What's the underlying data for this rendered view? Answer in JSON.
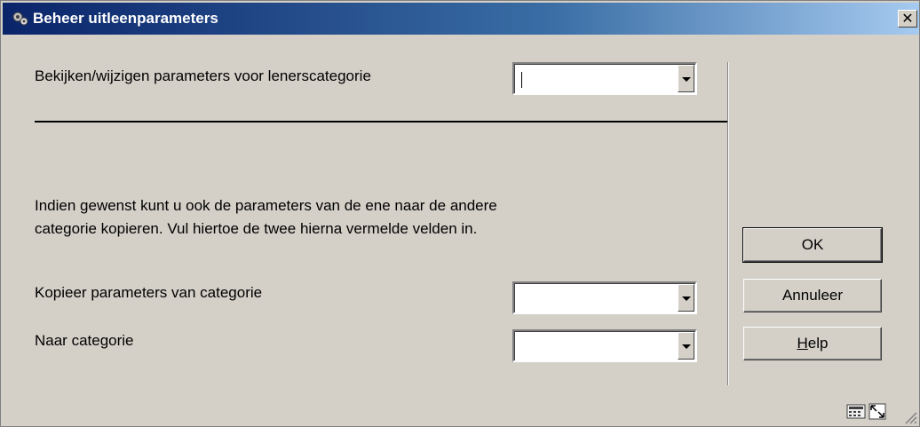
{
  "window": {
    "title": "Beheer uitleenparameters",
    "close_glyph": "✕"
  },
  "form": {
    "view_label": "Bekijken/wijzigen parameters voor lenerscategorie",
    "view_value": "",
    "info_line1": "Indien gewenst kunt u ook de parameters van de ene naar de andere",
    "info_line2": "categorie kopieren. Vul hiertoe de twee hierna vermelde velden in.",
    "copy_from_label": "Kopieer parameters van categorie",
    "copy_from_value": "",
    "copy_to_label": "Naar categorie",
    "copy_to_value": ""
  },
  "buttons": {
    "ok": "OK",
    "cancel": "Annuleer",
    "help_prefix": "H",
    "help_rest": "elp"
  },
  "icons": {
    "title": "app-gear-icon",
    "tray_left": "calculator-icon",
    "tray_right": "maximize-icon"
  }
}
